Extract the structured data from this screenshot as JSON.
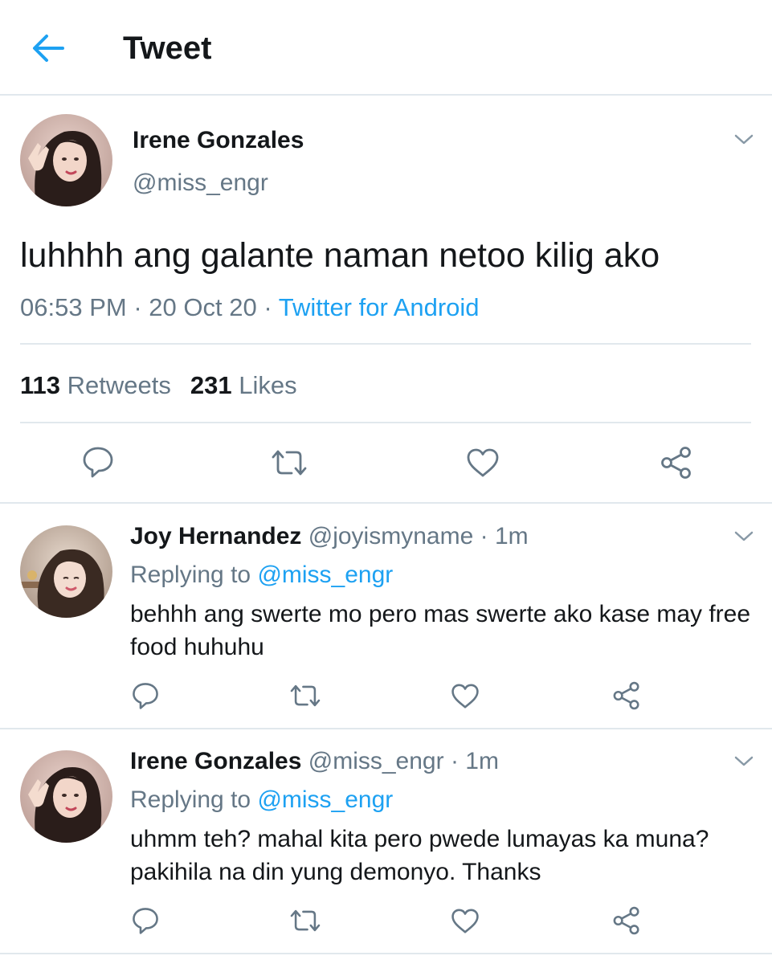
{
  "header": {
    "title": "Tweet"
  },
  "main_tweet": {
    "name": "Irene Gonzales",
    "handle": "@miss_engr",
    "text": "luhhhh ang galante naman netoo kilig ako",
    "time": "06:53 PM",
    "date": "20 Oct 20",
    "source": "Twitter for Android",
    "meta_sep": "·",
    "retweets_count": "113",
    "retweets_label": "Retweets",
    "likes_count": "231",
    "likes_label": "Likes"
  },
  "replies": [
    {
      "name": "Joy Hernandez",
      "handle": "@joyismyname",
      "sep": "·",
      "time": "1m",
      "replying_label": "Replying to",
      "replying_to": "@miss_engr",
      "text": "behhh ang swerte mo pero mas swerte ako kase may free food huhuhu"
    },
    {
      "name": "Irene Gonzales",
      "handle": "@miss_engr",
      "sep": "·",
      "time": "1m",
      "replying_label": "Replying to",
      "replying_to": "@miss_engr",
      "text": "uhmm teh? mahal kita pero pwede lumayas ka muna? pakihila na din yung demonyo. Thanks"
    }
  ],
  "icons": {
    "back": "arrow-left-icon",
    "menu": "chevron-down-icon",
    "reply": "speech-bubble-icon",
    "retweet": "retweet-icon",
    "like": "heart-icon",
    "share": "share-icon"
  },
  "colors": {
    "accent": "#1da1f2",
    "text": "#14171a",
    "secondary": "#657786",
    "divider": "#e1e8ed"
  }
}
